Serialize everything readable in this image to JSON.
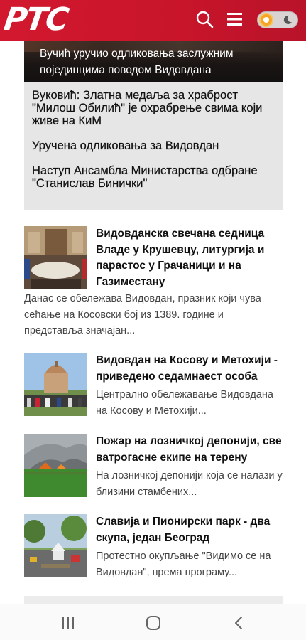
{
  "header": {
    "logo_text": "РТС",
    "search_icon": "search-icon",
    "menu_icon": "hamburger-menu-icon",
    "theme_toggle_icons": [
      "sun-icon",
      "moon-icon"
    ],
    "brand_color": "#d2182e"
  },
  "featured": {
    "title": "Вучић уручио одликовања заслужним појединцима поводом Видовдана",
    "related": [
      "Вуковић: Златна медаља за храброст \"Милош Обилић\" је охрабрење свима који живе на КиМ",
      "Уручена одликовања за Видовдан",
      "Наступ Ансамбла Министарства одбране \"Станислав Бинички\""
    ]
  },
  "news": [
    {
      "title": "Видовданска свечана седница Владе у Крушевцу, литургија и парастос у Грачаници и на Газиместану",
      "excerpt": "Данас се обележава Видовдан, празник који чува сећање на Косовски бој из 1389. године и представља значајан..."
    },
    {
      "title": "Видовдан на Косову и Метохији - приведено седамнаест особа",
      "excerpt": "Централно обележавање Видовдана на Косову и Метохији..."
    },
    {
      "title": "Пожар на лозничкој депонији, све ватрогасне екипе на терену",
      "excerpt": "На лозничкој депонији која се налази у близини стамбених..."
    },
    {
      "title": "Славија и Пионирски парк - два скупа, један Београд",
      "excerpt": "Протестно окупљање \"Видимо се на Видовдан\", према програму..."
    }
  ],
  "system_nav": {
    "icons": [
      "recent-apps-icon",
      "home-icon",
      "back-icon"
    ]
  }
}
